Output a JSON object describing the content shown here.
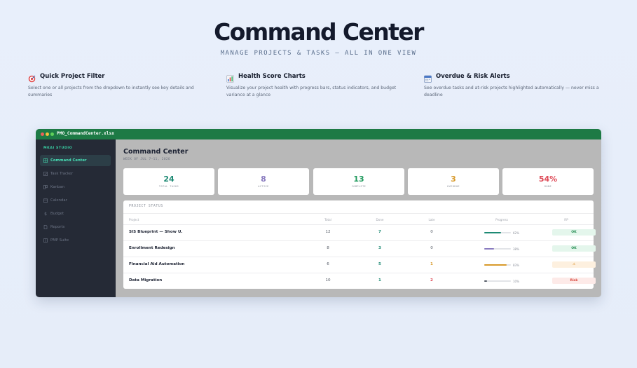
{
  "hero": {
    "title": "Command Center",
    "subtitle": "MANAGE PROJECTS & TASKS — ALL IN ONE VIEW"
  },
  "features": [
    {
      "icon": "target-icon",
      "title": "Quick Project Filter",
      "description": "Select one or all projects from the dropdown to instantly see key details and summaries"
    },
    {
      "icon": "bar-chart-icon",
      "title": "Health Score Charts",
      "description": "Visualize your project health with progress bars, status indicators, and budget variance at a glance"
    },
    {
      "icon": "calendar-icon",
      "title": "Overdue & Risk Alerts",
      "description": "See overdue tasks and at-risk projects highlighted automatically — never miss a deadline"
    }
  ],
  "window": {
    "filename": "PMO_CommandCenter.xlsx",
    "brand": "MKAI STUDIO",
    "nav": [
      {
        "label": "Command Center",
        "icon": "grid-icon",
        "active": true
      },
      {
        "label": "Task Tracker",
        "icon": "checklist-icon",
        "active": false
      },
      {
        "label": "Kanban",
        "icon": "kanban-icon",
        "active": false
      },
      {
        "label": "Calendar",
        "icon": "calendar-icon",
        "active": false
      },
      {
        "label": "Budget",
        "icon": "dollar-icon",
        "active": false
      },
      {
        "label": "Reports",
        "icon": "document-icon",
        "active": false
      },
      {
        "label": "PMP Suite",
        "icon": "book-icon",
        "active": false
      }
    ],
    "main": {
      "title": "Command Center",
      "subtitle": "WEEK OF JUL 7–11, 2026",
      "stats": [
        {
          "value": "24",
          "label": "TOTAL TASKS",
          "color": "#1e8a74"
        },
        {
          "value": "8",
          "label": "ACTIVE",
          "color": "#8a7cc0"
        },
        {
          "value": "13",
          "label": "COMPLETE",
          "color": "#1f9a5d"
        },
        {
          "value": "3",
          "label": "OVERDUE",
          "color": "#d89a2b"
        },
        {
          "value": "54%",
          "label": "DONE",
          "color": "#de4a57"
        }
      ],
      "panel_title": "PROJECT STATUS",
      "columns": [
        "Project",
        "Total",
        "Done",
        "Late",
        "Progress",
        "RP"
      ],
      "rows": [
        {
          "project": "SIS Blueprint — Show U.",
          "total": "12",
          "done": "7",
          "late": "0",
          "progress": 0.62,
          "progress_label": "62%",
          "progress_color": "#1e8a74",
          "status": "OK",
          "late_color": "#555b66"
        },
        {
          "project": "Enrollment Redesign",
          "total": "8",
          "done": "3",
          "late": "0",
          "progress": 0.38,
          "progress_label": "38%",
          "progress_color": "#8a7cc0",
          "status": "OK",
          "late_color": "#555b66"
        },
        {
          "project": "Financial Aid Automation",
          "total": "6",
          "done": "5",
          "late": "1",
          "progress": 0.83,
          "progress_label": "83%",
          "progress_color": "#d89a2b",
          "status": "⚠",
          "late_color": "#d89a2b"
        },
        {
          "project": "Data Migration",
          "total": "10",
          "done": "1",
          "late": "2",
          "progress": 0.1,
          "progress_label": "10%",
          "progress_color": "#555b66",
          "status": "Risk",
          "late_color": "#de4a57"
        }
      ]
    }
  }
}
